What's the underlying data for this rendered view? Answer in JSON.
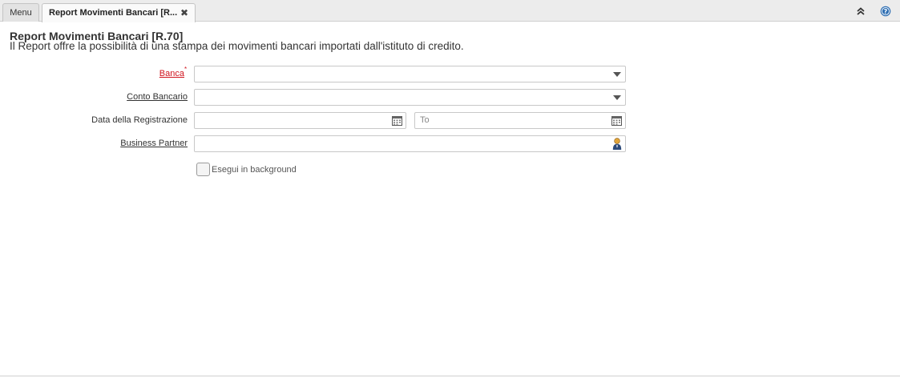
{
  "tabs": {
    "menu_label": "Menu",
    "active_label": "Report Movimenti Bancari [R...",
    "close_glyph": "✖"
  },
  "header": {
    "title": "Report Movimenti Bancari [R.70]",
    "description": "Il Report offre la possibilità di una stampa dei movimenti bancari importati dall'istituto di credito."
  },
  "form": {
    "banca": {
      "label": "Banca",
      "required_mark": "*",
      "value": ""
    },
    "conto_bancario": {
      "label": "Conto Bancario",
      "value": ""
    },
    "data_registrazione": {
      "label": "Data della Registrazione",
      "from_value": "",
      "to_placeholder": "To"
    },
    "business_partner": {
      "label": "Business Partner",
      "value": ""
    },
    "background": {
      "label": "Esegui in background",
      "checked": false
    }
  },
  "icons": {
    "dropdown": "chevron-down-icon",
    "calendar": "calendar-icon",
    "partner": "person-icon",
    "collapse": "double-chevron-up-icon",
    "help": "help-icon"
  },
  "colors": {
    "mandatory": "#d0141e",
    "help_icon": "#2f6fb3"
  }
}
